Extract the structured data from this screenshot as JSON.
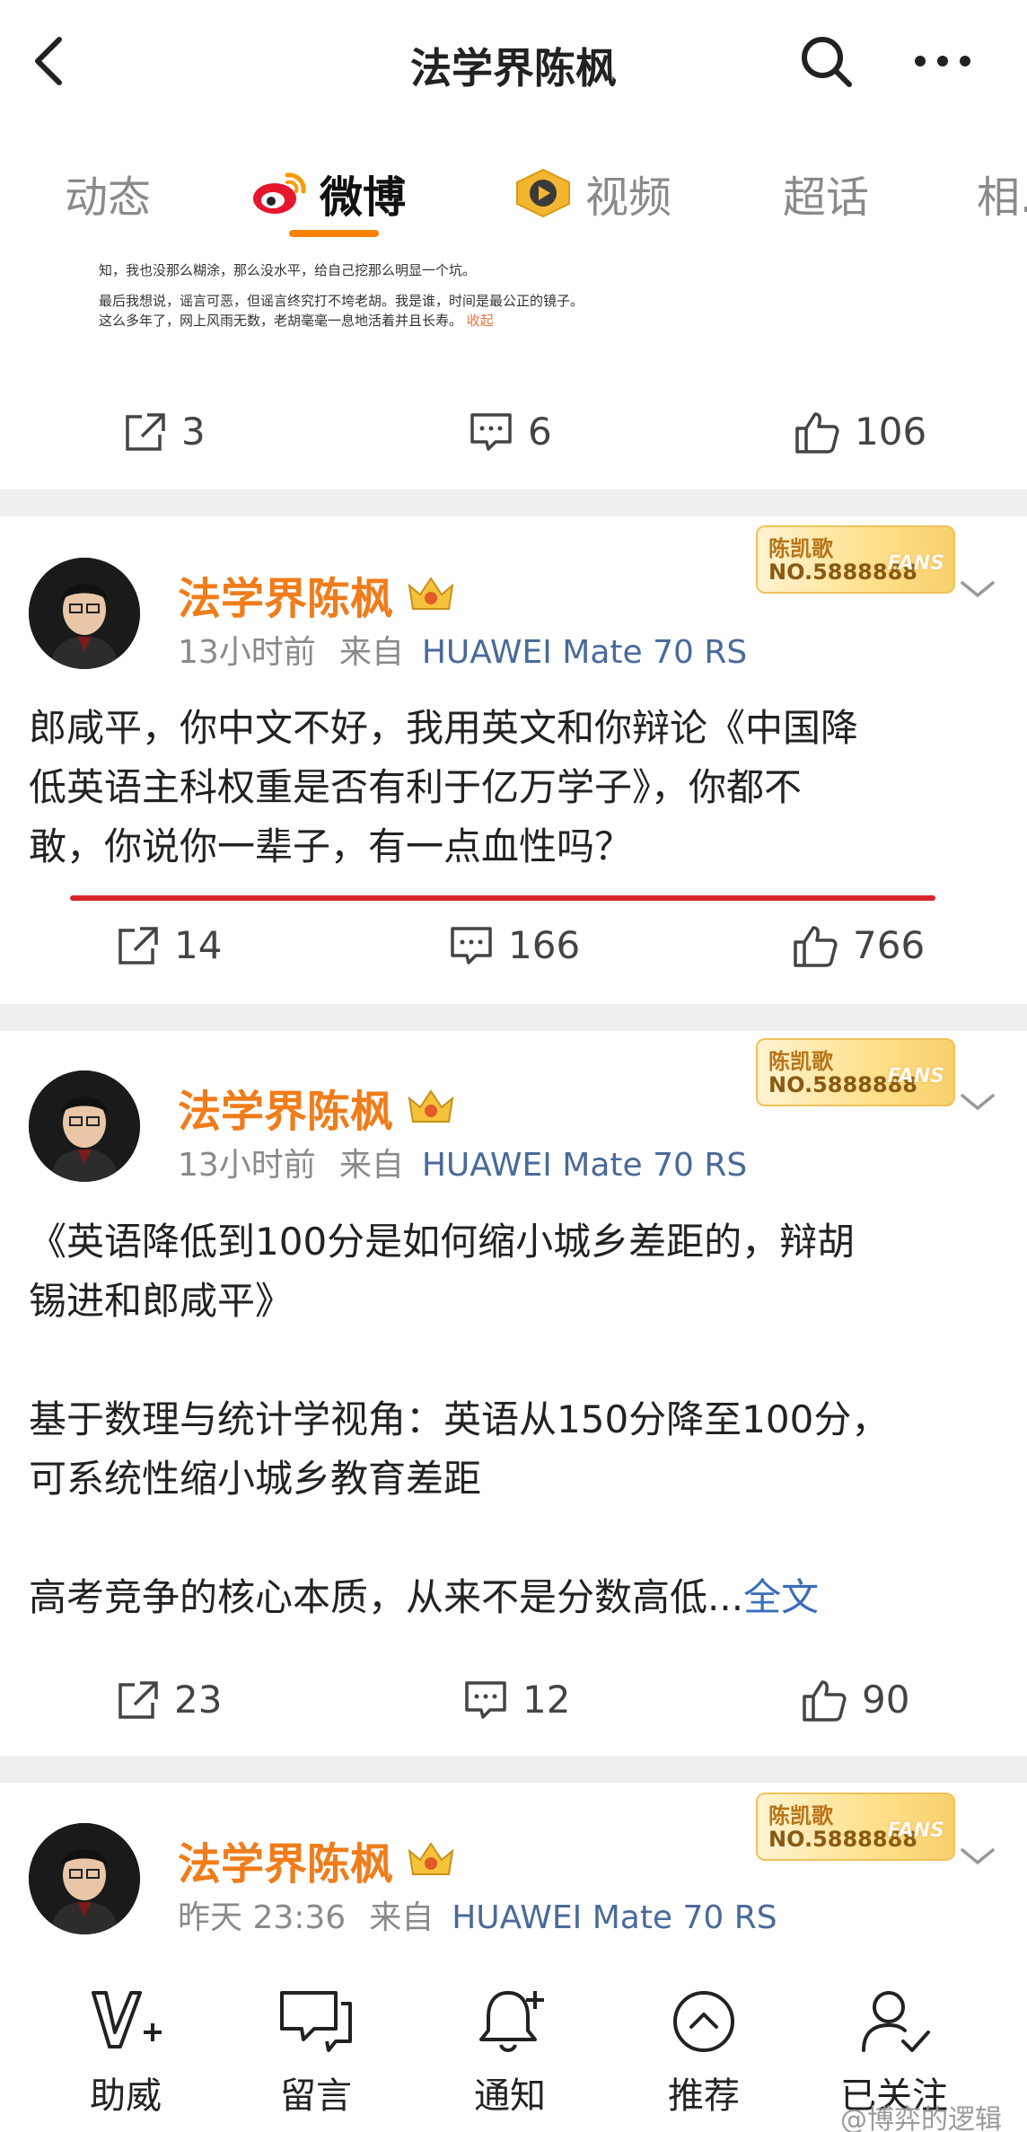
{
  "header": {
    "title": "法学界陈枫"
  },
  "tabs": [
    {
      "label": "动态"
    },
    {
      "label": "微博"
    },
    {
      "label": "视频"
    },
    {
      "label": "超话"
    },
    {
      "label": "相..."
    }
  ],
  "snippet": {
    "line1": "知，我也没那么糊涂，那么没水平，给自己挖那么明显一个坑。",
    "line2": "最后我想说，谣言可恶，但谣言终究打不垮老胡。我是谁，时间是最公正的镜子。",
    "line3": "这么多年了，网上风雨无数，老胡毫毫一息地活着并且长寿。",
    "fold": "收起"
  },
  "post0_actions": {
    "reposts": "3",
    "comments": "6",
    "likes": "106"
  },
  "posts": [
    {
      "author": "法学界陈枫",
      "time": "13小时前",
      "from": "来自",
      "device": "HUAWEI Mate 70 RS",
      "fans_name": "陈凯歌",
      "fans_no": "NO.5888888",
      "fans_tag": "FANS",
      "lines": [
        "郎咸平，你中文不好，我用英文和你辩论《中国降",
        "低英语主科权重是否有利于亿万学子》，你都不",
        "敢，你说你一辈子，有一点血性吗？"
      ],
      "reposts": "14",
      "comments": "166",
      "likes": "766"
    },
    {
      "author": "法学界陈枫",
      "time": "13小时前",
      "from": "来自",
      "device": "HUAWEI Mate 70 RS",
      "fans_name": "陈凯歌",
      "fans_no": "NO.5888888",
      "fans_tag": "FANS",
      "lines": [
        "《英语降低到100分是如何缩小城乡差距的，辩胡",
        "锡进和郎咸平》",
        "基于数理与统计学视角：英语从150分降至100分，",
        "可系统性缩小城乡教育差距",
        "高考竞争的核心本质，从来不是分数高低..."
      ],
      "more": "全文",
      "reposts": "23",
      "comments": "12",
      "likes": "90"
    },
    {
      "author": "法学界陈枫",
      "time": "昨天 23:36",
      "from": "来自",
      "device": "HUAWEI Mate 70 RS",
      "fans_name": "陈凯歌",
      "fans_no": "NO.5888888",
      "fans_tag": "FANS"
    }
  ],
  "bottom_nav": [
    {
      "label": "助威",
      "icon": "cheer-icon"
    },
    {
      "label": "留言",
      "icon": "message-icon"
    },
    {
      "label": "通知",
      "icon": "bell-icon"
    },
    {
      "label": "推荐",
      "icon": "recommend-icon"
    },
    {
      "label": "已关注",
      "icon": "followed-icon"
    }
  ],
  "watermark": "@博弈的逻辑",
  "colors": {
    "accent": "#ff8200",
    "username": "#f07c1a",
    "link": "#3b6db8",
    "underline_red": "#d7262a"
  }
}
